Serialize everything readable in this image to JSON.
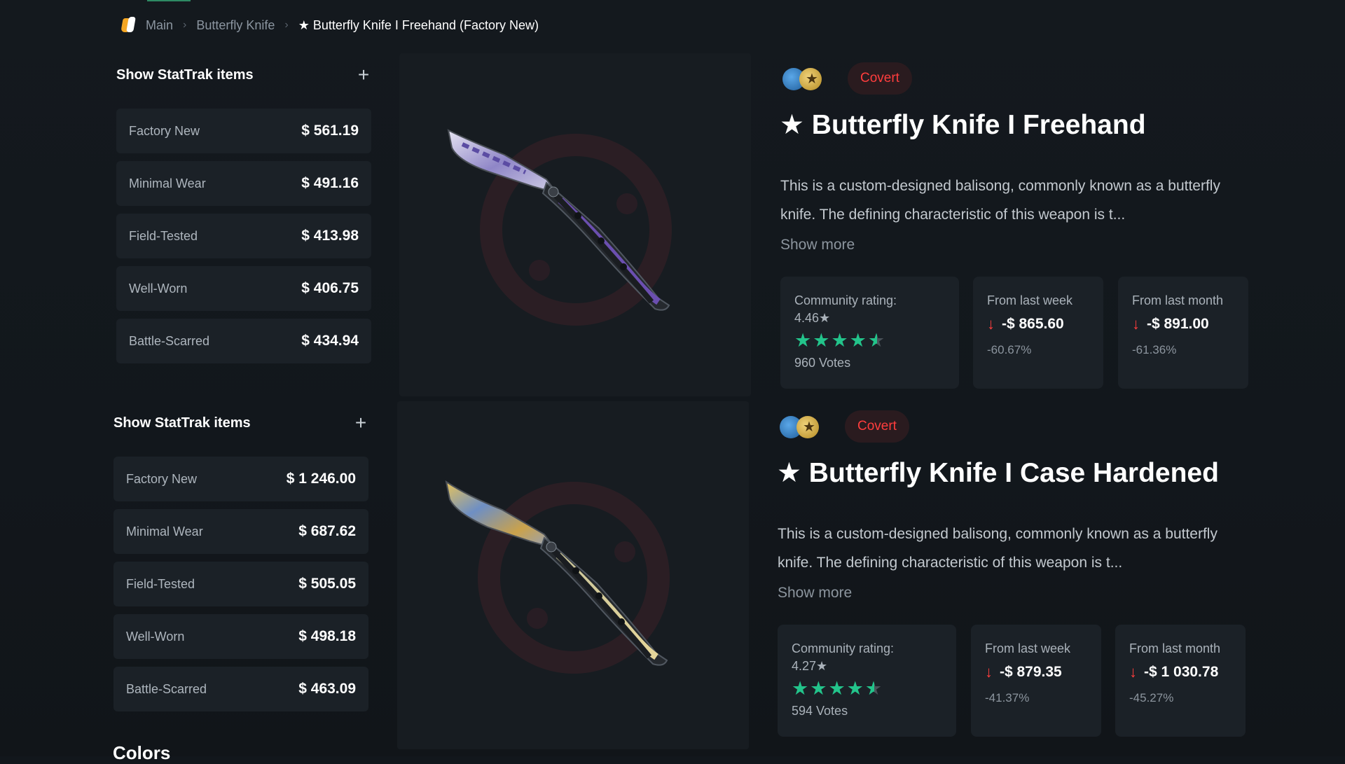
{
  "breadcrumb": {
    "items": [
      "Main",
      "Butterfly Knife"
    ],
    "current": "★ Butterfly Knife I Freehand (Factory New)"
  },
  "sections": [
    {
      "stattrak_label": "Show StatTrak items",
      "prices": [
        {
          "wear": "Factory New",
          "price": "$ 561.19"
        },
        {
          "wear": "Minimal Wear",
          "price": "$ 491.16"
        },
        {
          "wear": "Field-Tested",
          "price": "$ 413.98"
        },
        {
          "wear": "Well-Worn",
          "price": "$ 406.75"
        },
        {
          "wear": "Battle-Scarred",
          "price": "$ 434.94"
        }
      ],
      "rarity": "Covert",
      "rarity_color": "#ff3d3d",
      "title": "★ Butterfly Knife I Freehand",
      "description": "This is a custom-designed balisong, commonly known as a butterfly knife. The defining characteristic of this weapon is t...",
      "show_more": "Show more",
      "community": {
        "label": "Community rating:",
        "rating": "4.46★",
        "stars": 4.46,
        "votes": "960 Votes"
      },
      "week": {
        "label": "From last week",
        "value": "-$ 865.60",
        "pct": "-60.67%"
      },
      "month": {
        "label": "From last month",
        "value": "-$ 891.00",
        "pct": "-61.36%"
      },
      "skin_colors": [
        "#b8b5d6",
        "#6b4fb0",
        "#3a3f46"
      ]
    },
    {
      "stattrak_label": "Show StatTrak items",
      "prices": [
        {
          "wear": "Factory New",
          "price": "$ 1 246.00"
        },
        {
          "wear": "Minimal Wear",
          "price": "$ 687.62"
        },
        {
          "wear": "Field-Tested",
          "price": "$ 505.05"
        },
        {
          "wear": "Well-Worn",
          "price": "$ 498.18"
        },
        {
          "wear": "Battle-Scarred",
          "price": "$ 463.09"
        }
      ],
      "rarity": "Covert",
      "rarity_color": "#ff3d3d",
      "title": "★ Butterfly Knife I Case Hardened",
      "description": "This is a custom-designed balisong, commonly known as a butterfly knife. The defining characteristic of this weapon is t...",
      "show_more": "Show more",
      "community": {
        "label": "Community rating:",
        "rating": "4.27★",
        "stars": 4.27,
        "votes": "594 Votes"
      },
      "week": {
        "label": "From last week",
        "value": "-$ 879.35",
        "pct": "-41.37%"
      },
      "month": {
        "label": "From last month",
        "value": "-$ 1 030.78",
        "pct": "-45.27%"
      },
      "skin_colors": [
        "#d8b55a",
        "#5a7fb5",
        "#c7c29a"
      ]
    }
  ],
  "colors_heading": "Colors",
  "accent_color": "#23c48b"
}
